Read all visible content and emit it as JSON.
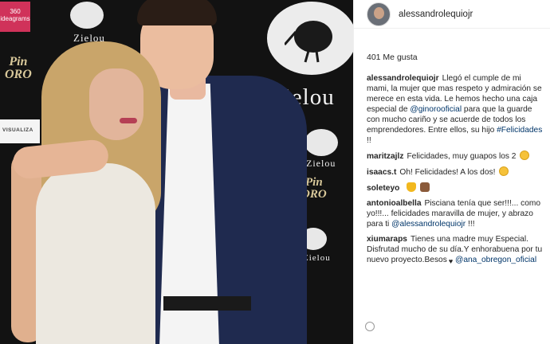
{
  "photo": {
    "brand_zielou": "Zielou",
    "brand_pinoro_top": "Pin",
    "brand_pinoro_bottom": "ORO",
    "badge_360": "360 ideagrams",
    "visualiza": "VISUALIZA"
  },
  "post": {
    "username": "alessandrolequiojr",
    "likes": "401 Me gusta",
    "caption": {
      "author": "alessandrolequiojr",
      "text_1": "Llegó el cumple de mi mami, la mujer que mas respeto y admiración se merece en esta vida. Le hemos hecho una caja especial de ",
      "mention": "@ginorooficial",
      "text_2": " para que la guarde con mucho cariño y se acuerde de todos los emprendedores. Entre ellos, su hijo ",
      "hashtag": "#Felicidades",
      "text_3": " !!"
    },
    "comments": [
      {
        "author": "maritzajlz",
        "text": "Felicidades, muy guapos los 2"
      },
      {
        "author": "isaacs.t",
        "text": "Oh! Felicidades! A los dos!"
      },
      {
        "author": "soleteyo",
        "text": ""
      },
      {
        "author": "antonioalbella",
        "text": "Pisciana tenía que ser!!!... como yo!!!... felicidades maravilla de mujer, y abrazo para ti",
        "mention": "@alessandrolequiojr",
        "tail": " !!!"
      },
      {
        "author": "xiumaraps",
        "text": "Tienes una madre muy Especial. Disfrutad mucho de su día.Y enhorabuena por tu nuevo proyecto.Besos",
        "mention": "@ana_obregon_oficial"
      }
    ]
  },
  "icons": {
    "avatar": "profile-photo",
    "emoji_smile": "smiling-face",
    "emoji_trophy": "trophy",
    "emoji_cake": "cake",
    "emoji_heart": "black-heart",
    "kiwi_logo": "kiwi-bird"
  },
  "colors": {
    "link": "#003569",
    "text": "#262626",
    "backdrop": "#121212"
  }
}
